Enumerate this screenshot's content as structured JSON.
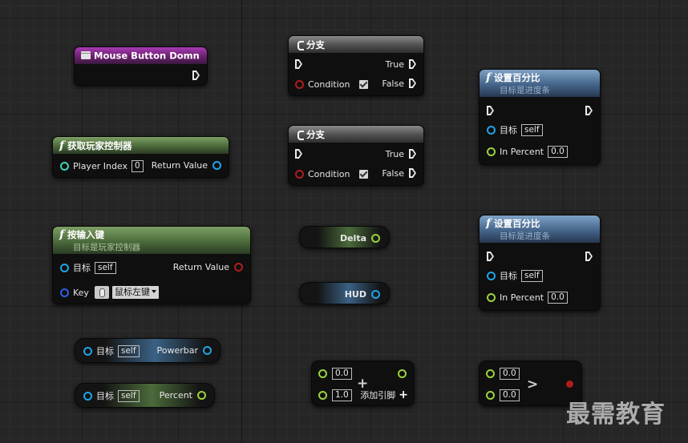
{
  "mouse_node": {
    "title": "Mouse Button Domn"
  },
  "branch1": {
    "title": "分支",
    "true_label": "True",
    "false_label": "False",
    "condition_label": "Condition"
  },
  "branch2": {
    "title": "分支",
    "true_label": "True",
    "false_label": "False",
    "condition_label": "Condition"
  },
  "set_percent1": {
    "title": "设置百分比",
    "subtitle": "目标是进度条",
    "target_label": "目标",
    "target_value": "self",
    "percent_label": "In Percent",
    "percent_value": "0.0"
  },
  "set_percent2": {
    "title": "设置百分比",
    "subtitle": "目标是进度条",
    "target_label": "目标",
    "target_value": "self",
    "percent_label": "In Percent",
    "percent_value": "0.0"
  },
  "get_player_controller": {
    "title": "获取玩家控制器",
    "player_index_label": "Player Index",
    "player_index_value": "0",
    "return_label": "Return Value"
  },
  "is_input_key_down": {
    "title": "按输入键",
    "subtitle": "目标是玩家控制器",
    "target_label": "目标",
    "target_value": "self",
    "return_label": "Return Value",
    "key_label": "Key",
    "key_value": "鼠标左键"
  },
  "delta_var": {
    "label": "Delta"
  },
  "hud_var": {
    "label": "HUD"
  },
  "powerbar_get": {
    "target_label": "目标",
    "target_value": "self",
    "output_label": "Powerbar"
  },
  "percent_get": {
    "target_label": "目标",
    "target_value": "self",
    "output_label": "Percent"
  },
  "add_node": {
    "a_value": "0.0",
    "b_value": "1.0",
    "operator": "+",
    "add_pin_label": "添加引脚",
    "add_pin_symbol": "+"
  },
  "compare_node": {
    "a_value": "0.0",
    "b_value": "0.0",
    "operator": ">"
  },
  "watermark": {
    "text": "最需教育"
  },
  "colors": {
    "exec": "#eaeaea",
    "object_pin": "#1fa3e6",
    "float_pin": "#9ad33c",
    "bool_pin": "#b01d1d"
  }
}
